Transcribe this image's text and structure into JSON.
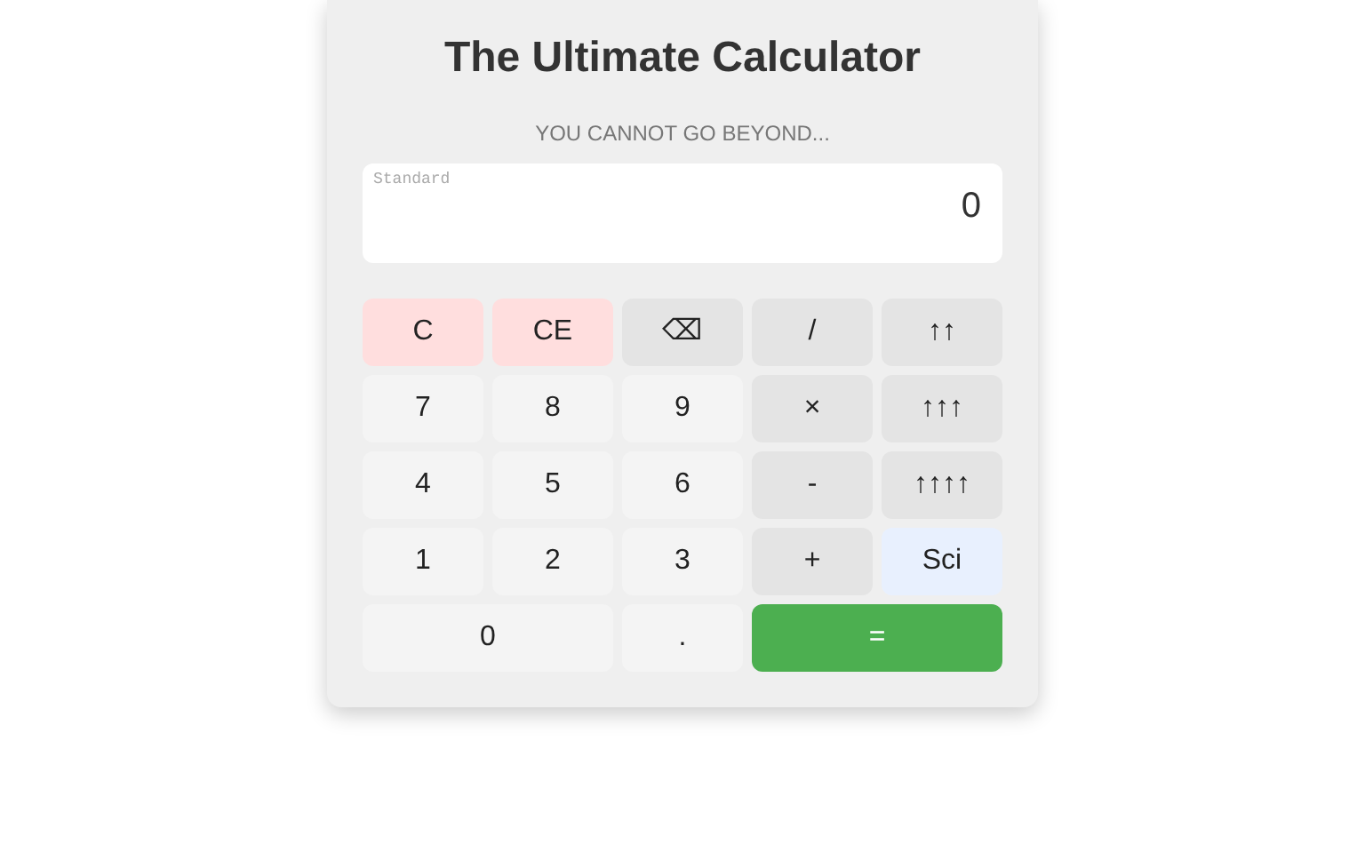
{
  "title": "The Ultimate Calculator",
  "subtitle": "YOU CANNOT GO BEYOND...",
  "display": {
    "mode": "Standard",
    "value": "0"
  },
  "keys": [
    {
      "label": "C",
      "kind": "clear",
      "wide": false
    },
    {
      "label": "CE",
      "kind": "clear",
      "wide": false
    },
    {
      "label": "⌫",
      "kind": "op",
      "wide": false
    },
    {
      "label": "/",
      "kind": "op",
      "wide": false
    },
    {
      "label": "↑↑",
      "kind": "op",
      "wide": false
    },
    {
      "label": "7",
      "kind": "digit",
      "wide": false
    },
    {
      "label": "8",
      "kind": "digit",
      "wide": false
    },
    {
      "label": "9",
      "kind": "digit",
      "wide": false
    },
    {
      "label": "×",
      "kind": "op",
      "wide": false
    },
    {
      "label": "↑↑↑",
      "kind": "op",
      "wide": false
    },
    {
      "label": "4",
      "kind": "digit",
      "wide": false
    },
    {
      "label": "5",
      "kind": "digit",
      "wide": false
    },
    {
      "label": "6",
      "kind": "digit",
      "wide": false
    },
    {
      "label": "-",
      "kind": "op",
      "wide": false
    },
    {
      "label": "↑↑↑↑",
      "kind": "op",
      "wide": false
    },
    {
      "label": "1",
      "kind": "digit",
      "wide": false
    },
    {
      "label": "2",
      "kind": "digit",
      "wide": false
    },
    {
      "label": "3",
      "kind": "digit",
      "wide": false
    },
    {
      "label": "+",
      "kind": "op",
      "wide": false
    },
    {
      "label": "Sci",
      "kind": "mode",
      "wide": false
    },
    {
      "label": "0",
      "kind": "digit",
      "wide": true
    },
    {
      "label": ".",
      "kind": "digit",
      "wide": false
    },
    {
      "label": "=",
      "kind": "equals",
      "wide": true
    }
  ]
}
